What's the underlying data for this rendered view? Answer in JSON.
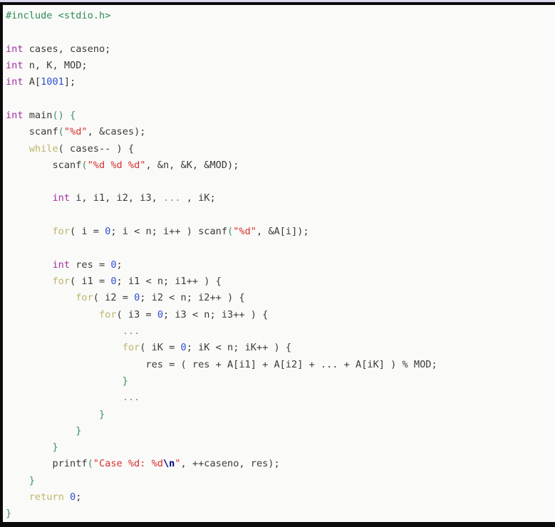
{
  "editor": {
    "language": "C",
    "background_color": "#fafaf8",
    "border_color": "#0b0b0b",
    "top_strip_color": "#d8d8ee",
    "default_text_color": "#3a3a3a"
  },
  "palette": {
    "preprocessor": "#2e8b57",
    "type_keyword": "#a330a3",
    "control_keyword": "#bdb76b",
    "string": "#d63030",
    "escape": "#00007f",
    "number": "#2f4fd0",
    "operator": "#3f8f5f",
    "identifier": "#3a3a3a",
    "ellipsis": "#8a8a8a"
  },
  "code": {
    "line_01": "#include <stdio.h>",
    "line_02": "",
    "line_03_a": "int",
    "line_03_b": " cases, caseno;",
    "line_04_a": "int",
    "line_04_b": " n, K, MOD;",
    "line_05_a": "int",
    "line_05_b": " A[",
    "line_05_c": "1001",
    "line_05_d": "];",
    "line_06": "",
    "line_07_a": "int",
    "line_07_b": " main",
    "line_07_c": "() {",
    "line_08_a": "    scanf",
    "line_08_b": "(",
    "line_08_c": "\"%d\"",
    "line_08_d": ", &cases);",
    "line_09_a": "    ",
    "line_09_b": "while",
    "line_09_c": "( cases-- ) {",
    "line_10_a": "        scanf",
    "line_10_b": "(",
    "line_10_c": "\"%d %d %d\"",
    "line_10_d": ", &n, &K, &MOD);",
    "line_11": "",
    "line_12_a": "        ",
    "line_12_b": "int",
    "line_12_c": " i, i1, i2, i3, ",
    "line_12_d": "...",
    "line_12_e": " , iK;",
    "line_13": "",
    "line_14_a": "        ",
    "line_14_b": "for",
    "line_14_c": "( i = ",
    "line_14_d": "0",
    "line_14_e": "; i < n; i++ ) scanf",
    "line_14_f": "(",
    "line_14_g": "\"%d\"",
    "line_14_h": ", &A[i]);",
    "line_15": "",
    "line_16_a": "        ",
    "line_16_b": "int",
    "line_16_c": " res = ",
    "line_16_d": "0",
    "line_16_e": ";",
    "line_17_a": "        ",
    "line_17_b": "for",
    "line_17_c": "( i1 = ",
    "line_17_d": "0",
    "line_17_e": "; i1 < n; i1++ ) {",
    "line_18_a": "            ",
    "line_18_b": "for",
    "line_18_c": "( i2 = ",
    "line_18_d": "0",
    "line_18_e": "; i2 < n; i2++ ) {",
    "line_19_a": "                ",
    "line_19_b": "for",
    "line_19_c": "( i3 = ",
    "line_19_d": "0",
    "line_19_e": "; i3 < n; i3++ ) {",
    "line_20_a": "                    ",
    "line_20_b": "...",
    "line_21_a": "                    ",
    "line_21_b": "for",
    "line_21_c": "( iK = ",
    "line_21_d": "0",
    "line_21_e": "; iK < n; iK++ ) {",
    "line_22_a": "                        res = ( res + A[i1] + A[i2] + ... + A[iK] ) % MOD;",
    "line_23": "                    }",
    "line_24_a": "                    ",
    "line_24_b": "...",
    "line_25": "                }",
    "line_26": "            }",
    "line_27": "        }",
    "line_28_a": "        printf",
    "line_28_b": "(",
    "line_28_c": "\"Case %d: %d",
    "line_28_d": "\\n",
    "line_28_e": "\"",
    "line_28_f": ", ++caseno, res);",
    "line_29": "    }",
    "line_30_a": "    ",
    "line_30_b": "return",
    "line_30_c": " ",
    "line_30_d": "0",
    "line_30_e": ";",
    "line_31": "}"
  }
}
